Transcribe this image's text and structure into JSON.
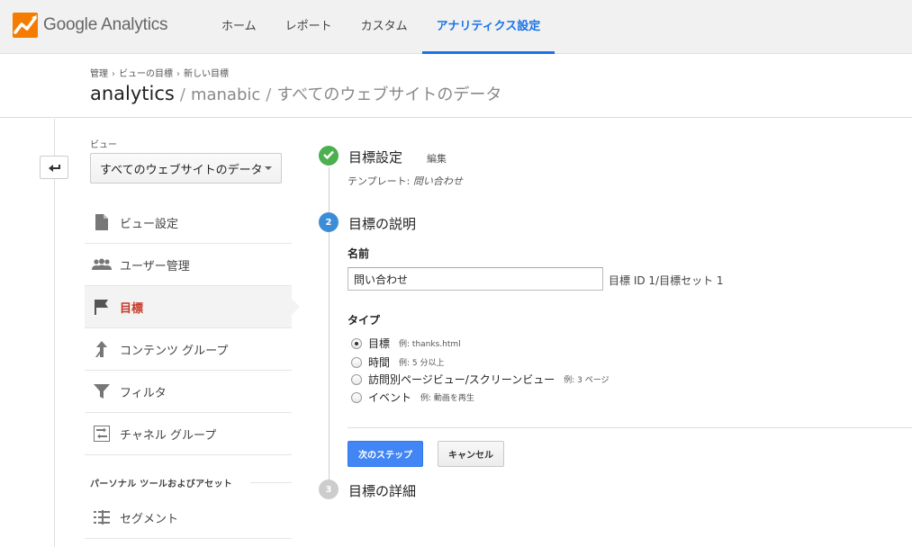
{
  "app": {
    "logo_text": "Google Analytics",
    "logo_icon": "analytics-logo-icon"
  },
  "nav": {
    "items": [
      {
        "label": "ホーム",
        "active": false
      },
      {
        "label": "レポート",
        "active": false
      },
      {
        "label": "カスタム",
        "active": false
      },
      {
        "label": "アナリティクス設定",
        "active": true
      }
    ]
  },
  "breadcrumb": {
    "items": [
      "管理",
      "ビューの目標",
      "新しい目標"
    ],
    "separator": "›"
  },
  "account_path": {
    "account": "analytics",
    "property": "manabic",
    "view": "すべてのウェブサイトのデータ",
    "separator": "/"
  },
  "sidebar": {
    "view_label": "ビュー",
    "view_selected": "すべてのウェブサイトのデータ",
    "items": [
      {
        "label": "ビュー設定",
        "icon": "document-icon"
      },
      {
        "label": "ユーザー管理",
        "icon": "users-icon"
      },
      {
        "label": "目標",
        "icon": "flag-icon",
        "active": true
      },
      {
        "label": "コンテンツ グループ",
        "icon": "content-group-icon"
      },
      {
        "label": "フィルタ",
        "icon": "filter-icon"
      },
      {
        "label": "チャネル グループ",
        "icon": "channel-group-icon"
      }
    ],
    "section_title": "パーソナル ツールおよびアセット",
    "segment_label": "セグメント",
    "segment_icon": "segment-icon"
  },
  "steps": {
    "step1": {
      "title": "目標設定",
      "edit": "編集",
      "template_label": "テンプレート:",
      "template_value": "問い合わせ",
      "status": "done"
    },
    "step2": {
      "number": "2",
      "title": "目標の説明"
    },
    "step3": {
      "number": "3",
      "title": "目標の詳細"
    }
  },
  "form": {
    "name_label": "名前",
    "name_value": "問い合わせ",
    "goal_id": "目標 ID 1/目標セット 1",
    "type_label": "タイプ",
    "types": [
      {
        "label": "目標",
        "example": "例: thanks.html",
        "selected": true
      },
      {
        "label": "時間",
        "example": "例: 5 分以上",
        "selected": false
      },
      {
        "label": "訪問別ページビュー/スクリーンビュー",
        "example": "例: 3 ページ",
        "selected": false
      },
      {
        "label": "イベント",
        "example": "例: 動画を再生",
        "selected": false
      }
    ],
    "next_button": "次のステップ",
    "cancel_button": "キャンセル"
  },
  "colors": {
    "accent": "#1a73e8",
    "active_menu": "#c53929",
    "done": "#4caf50",
    "current_step": "#3c8dd8",
    "primary_button": "#4285f4"
  }
}
